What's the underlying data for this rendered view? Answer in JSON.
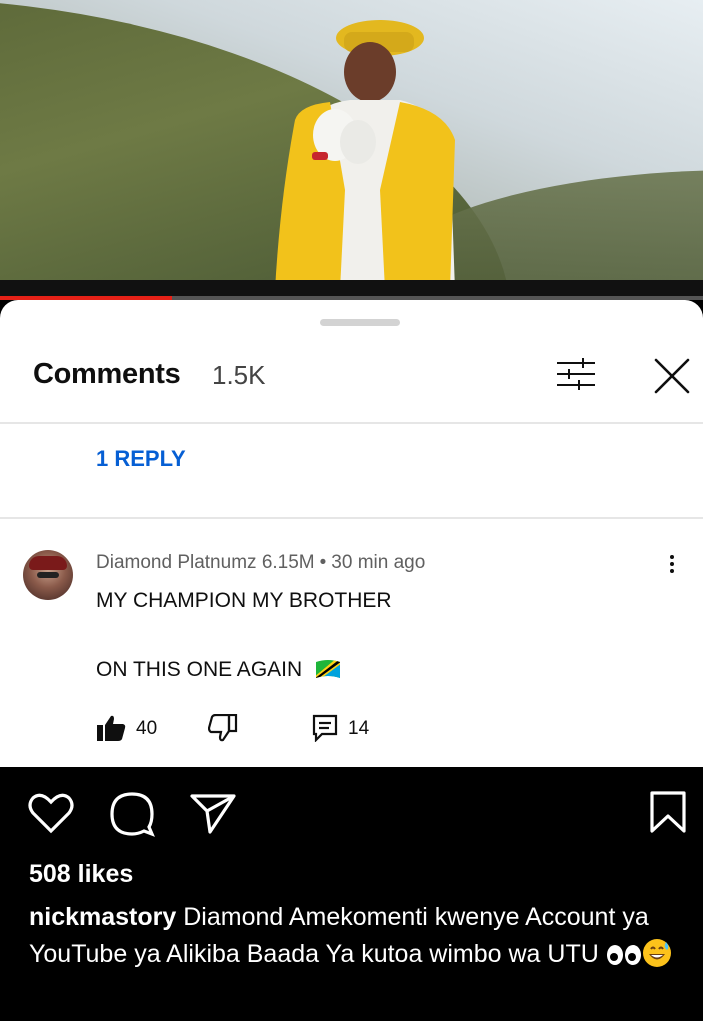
{
  "video": {
    "progress_fraction": 0.245,
    "accent_color": "#e62117"
  },
  "comments_panel": {
    "title": "Comments",
    "count": "1.5K",
    "filter_icon": "sliders-icon",
    "close_icon": "close-icon",
    "reply_link": "1 REPLY",
    "comment": {
      "author": "Diamond Platnumz",
      "author_subscribers": "6.15M",
      "separator": "•",
      "time_ago": "30 min ago",
      "line1": "MY CHAMPION MY BROTHER",
      "line2": "ON THIS ONE AGAIN",
      "flag_icon": "tanzania-flag-icon",
      "likes": "40",
      "replies": "14"
    }
  },
  "instagram": {
    "likes": "508 likes",
    "caption_user": "nickmastory",
    "caption_text": " Diamond Amekomenti kwenye Account ya YouTube ya Alikiba Baada Ya kutoa wimbo wa UTU "
  },
  "colors": {
    "link_blue": "#065fd4",
    "text_primary": "#0f0f0f",
    "text_secondary": "#606060"
  }
}
